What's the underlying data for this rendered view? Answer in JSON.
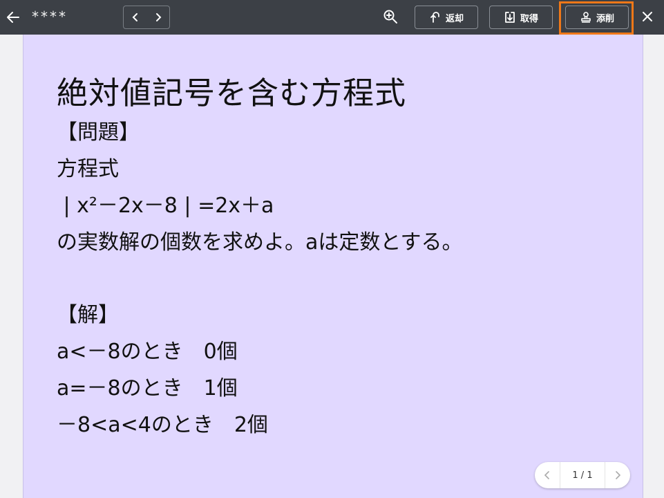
{
  "topbar": {
    "title": "****",
    "buttons": {
      "return_label": "返却",
      "take_label": "取得",
      "mark_label": "添削"
    }
  },
  "document": {
    "heading": "絶対値記号を含む方程式",
    "problem_header": "【問題】",
    "problem_lines": [
      "方程式",
      " | x²－2x－8 | =2x＋a",
      "の実数解の個数を求めよ。aは定数とする。"
    ],
    "solution_header": "【解】",
    "solution_lines": [
      "a<－8のとき　0個",
      "a=－8のとき　1個",
      "－8<a<4のとき　2個"
    ]
  },
  "pagination": {
    "indicator": "1 / 1"
  },
  "colors": {
    "topbar": "#3c4046",
    "page": "#e1d8ff",
    "highlight": "#f07818"
  },
  "icons": [
    "back-arrow-icon",
    "chevron-left-icon",
    "chevron-right-icon",
    "zoom-in-icon",
    "return-icon",
    "download-icon",
    "stamp-icon",
    "close-icon"
  ]
}
